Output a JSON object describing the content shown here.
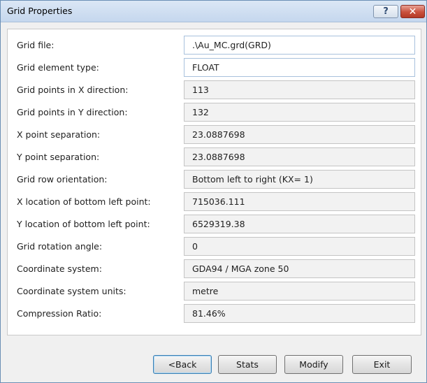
{
  "window": {
    "title": "Grid Properties",
    "help_glyph": "?",
    "close_glyph": "✕"
  },
  "fields": [
    {
      "label": "Grid file:",
      "value": ".\\Au_MC.grd(GRD)"
    },
    {
      "label": "Grid element type:",
      "value": "FLOAT"
    },
    {
      "label": "Grid points in X direction:",
      "value": "113"
    },
    {
      "label": "Grid points in Y direction:",
      "value": "132"
    },
    {
      "label": "X point separation:",
      "value": "23.0887698"
    },
    {
      "label": "Y point separation:",
      "value": "23.0887698"
    },
    {
      "label": "Grid row orientation:",
      "value": "Bottom left to right (KX= 1)"
    },
    {
      "label": "X location of bottom left point:",
      "value": "715036.111"
    },
    {
      "label": "Y location of bottom left point:",
      "value": "6529319.38"
    },
    {
      "label": "Grid rotation angle:",
      "value": "0"
    },
    {
      "label": "Coordinate system:",
      "value": "GDA94 / MGA zone 50"
    },
    {
      "label": "Coordinate system units:",
      "value": "metre"
    },
    {
      "label": "Compression Ratio:",
      "value": "81.46%"
    }
  ],
  "buttons": {
    "back": "<Back",
    "stats": "Stats",
    "modify": "Modify",
    "exit": "Exit"
  },
  "colors": {
    "titlebar": "#c5d7ee",
    "close_button": "#c9503c",
    "default_button_border": "#3c7fb1"
  }
}
